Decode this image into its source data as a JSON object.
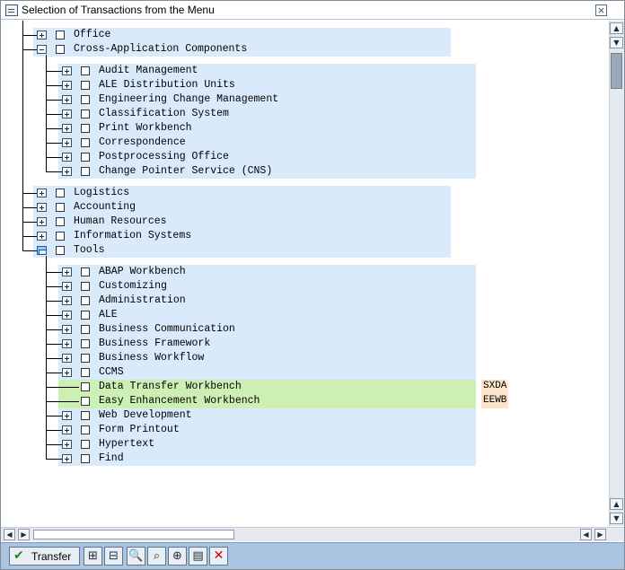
{
  "window": {
    "title": "Selection of Transactions from the Menu",
    "close_glyph": "×"
  },
  "tree": {
    "nodes": [
      {
        "label": "Office",
        "level": 1,
        "state": "collapsed"
      },
      {
        "label": "Cross-Application Components",
        "level": 1,
        "state": "expanded"
      },
      {
        "label": "Audit Management",
        "level": 2,
        "state": "collapsed"
      },
      {
        "label": "ALE Distribution Units",
        "level": 2,
        "state": "collapsed"
      },
      {
        "label": "Engineering Change Management",
        "level": 2,
        "state": "collapsed"
      },
      {
        "label": "Classification System",
        "level": 2,
        "state": "collapsed"
      },
      {
        "label": "Print Workbench",
        "level": 2,
        "state": "collapsed"
      },
      {
        "label": "Correspondence",
        "level": 2,
        "state": "collapsed"
      },
      {
        "label": "Postprocessing Office",
        "level": 2,
        "state": "collapsed"
      },
      {
        "label": "Change Pointer Service (CNS)",
        "level": 2,
        "state": "collapsed"
      },
      {
        "label": "Logistics",
        "level": 1,
        "state": "collapsed"
      },
      {
        "label": "Accounting",
        "level": 1,
        "state": "collapsed"
      },
      {
        "label": "Human Resources",
        "level": 1,
        "state": "collapsed"
      },
      {
        "label": "Information Systems",
        "level": 1,
        "state": "collapsed"
      },
      {
        "label": "Tools",
        "level": 1,
        "state": "expanded-selected"
      },
      {
        "label": "ABAP Workbench",
        "level": 2,
        "state": "collapsed"
      },
      {
        "label": "Customizing",
        "level": 2,
        "state": "collapsed"
      },
      {
        "label": "Administration",
        "level": 2,
        "state": "collapsed"
      },
      {
        "label": "ALE",
        "level": 2,
        "state": "collapsed"
      },
      {
        "label": "Business Communication",
        "level": 2,
        "state": "collapsed"
      },
      {
        "label": "Business Framework",
        "level": 2,
        "state": "collapsed"
      },
      {
        "label": "Business Workflow",
        "level": 2,
        "state": "collapsed"
      },
      {
        "label": "CCMS",
        "level": 2,
        "state": "collapsed"
      },
      {
        "label": "Data Transfer Workbench",
        "level": 2,
        "state": "leaf",
        "tcode": "SXDA",
        "highlight_color": "#ccf0b4"
      },
      {
        "label": "Easy Enhancement Workbench",
        "level": 2,
        "state": "leaf",
        "tcode": "EEWB",
        "highlight_color": "#ccf0b4"
      },
      {
        "label": "Web Development",
        "level": 2,
        "state": "collapsed"
      },
      {
        "label": "Form Printout",
        "level": 2,
        "state": "collapsed"
      },
      {
        "label": "Hypertext",
        "level": 2,
        "state": "collapsed"
      },
      {
        "label": "Find",
        "level": 2,
        "state": "collapsed"
      }
    ]
  },
  "scrollbar": {
    "up_glyph": "▲",
    "down_glyph": "▼",
    "left_glyph": "◀",
    "right_glyph": "▶"
  },
  "toolbar": {
    "transfer_label": "Transfer",
    "transfer_icon": "check-icon",
    "buttons": [
      {
        "name": "expand-subtree-button",
        "icon": "expand-subtree-icon",
        "glyph": "⊞"
      },
      {
        "name": "collapse-subtree-button",
        "icon": "collapse-subtree-icon",
        "glyph": "⊟"
      },
      {
        "name": "find-button",
        "icon": "magnifier-icon",
        "glyph": "🔍"
      },
      {
        "name": "find-next-button",
        "icon": "binoculars-icon",
        "glyph": "⌕"
      },
      {
        "name": "find-next-plus-button",
        "icon": "binoculars-plus-icon",
        "glyph": "⊕"
      },
      {
        "name": "details-button",
        "icon": "details-icon",
        "glyph": "▤"
      },
      {
        "name": "cancel-button",
        "icon": "cancel-icon",
        "glyph": "✕"
      }
    ]
  },
  "colors": {
    "row_bg": "#d9ebfb",
    "highlight_bg": "#ccf0b4",
    "tcode_bg": "#fde4cc",
    "toolbar_bg": "#a9c4e0"
  }
}
